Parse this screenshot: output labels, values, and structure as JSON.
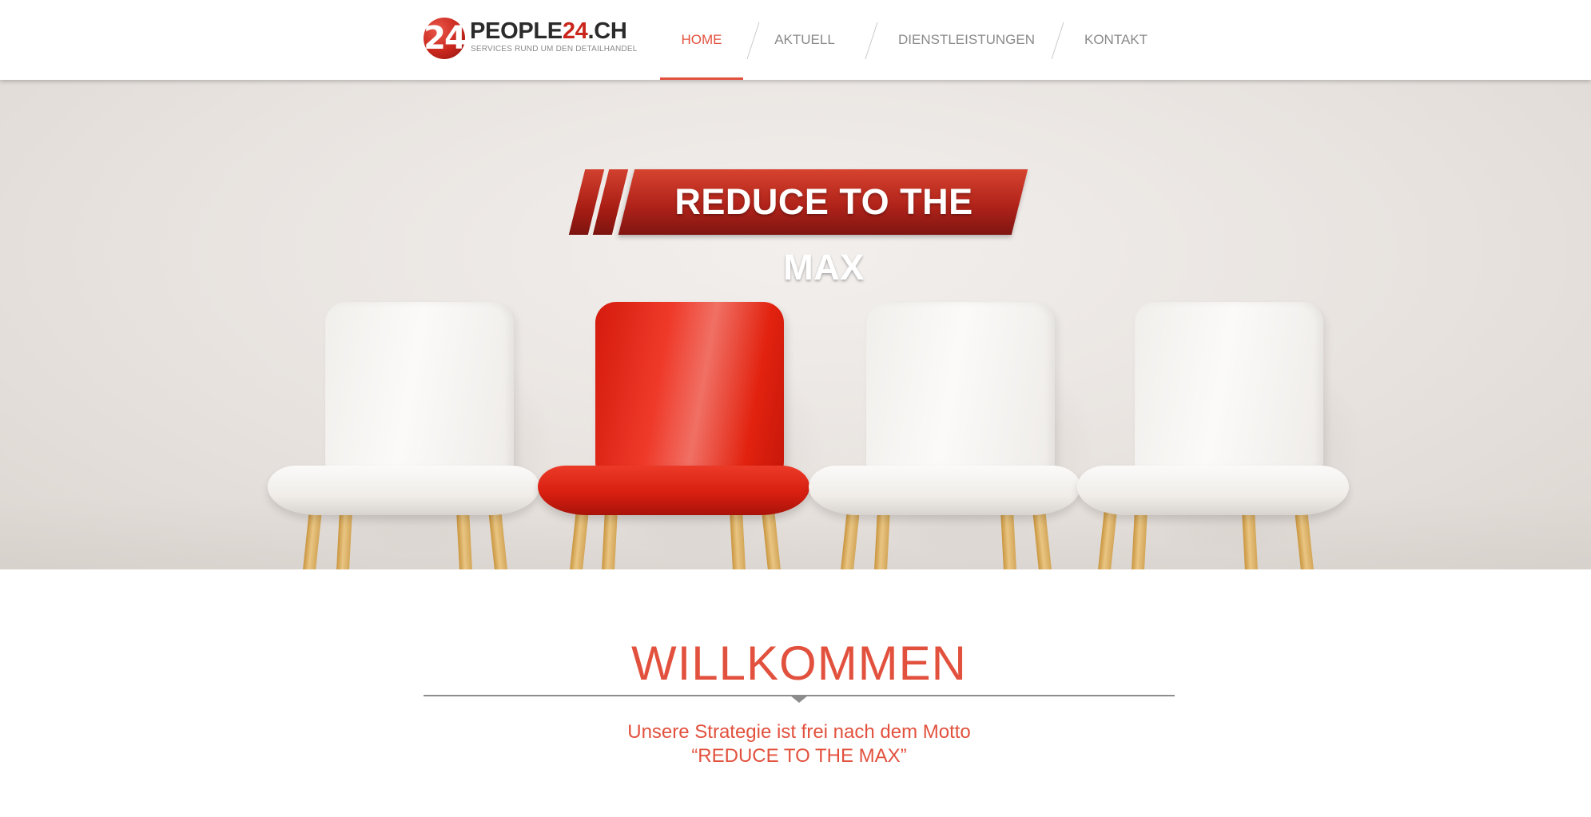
{
  "logo": {
    "badge": "24",
    "name_main": "PEOPLE",
    "name_highlight": "24",
    "name_suffix": ".CH",
    "tagline": "SERVICES RUND UM DEN DETAILHANDEL"
  },
  "nav": {
    "items": [
      {
        "label": "HOME",
        "active": true
      },
      {
        "label": "AKTUELL",
        "active": false
      },
      {
        "label": "DIENSTLEISTUNGEN",
        "active": false
      },
      {
        "label": "KONTAKT",
        "active": false
      }
    ]
  },
  "hero": {
    "banner_text": "REDUCE TO THE MAX",
    "chairs": [
      "white",
      "red",
      "white",
      "white"
    ]
  },
  "content": {
    "title": "WILLKOMMEN",
    "motto_line1": "Unsere Strategie ist frei nach dem Motto",
    "motto_line2": "“REDUCE TO THE MAX”"
  },
  "colors": {
    "accent": "#e2513e",
    "brand_red": "#c9261c",
    "nav_text": "#8a8a8a",
    "divider": "#8d8d8d"
  }
}
